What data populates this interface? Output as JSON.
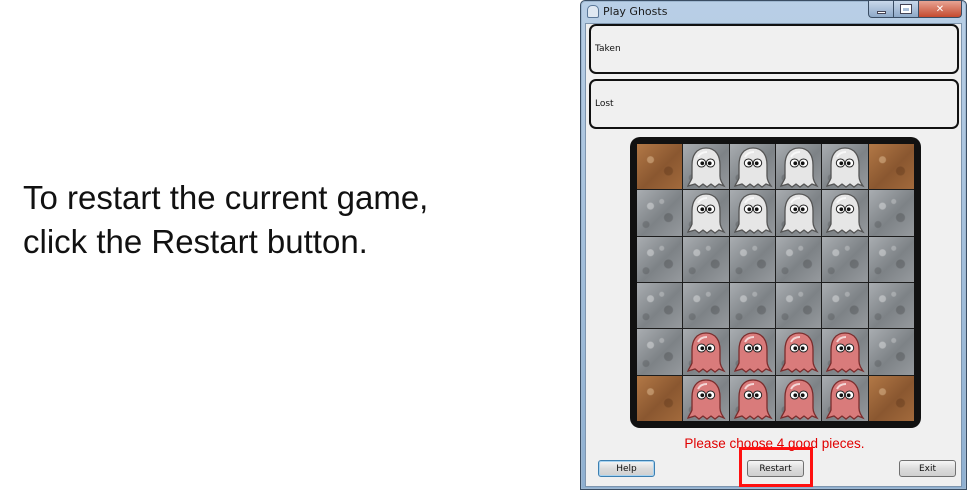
{
  "instruction": {
    "line1": "To restart the current game,",
    "line2_prefix": "click the ",
    "line2_bold": "Restart",
    "line2_suffix": " button."
  },
  "window": {
    "title": "Play Ghosts",
    "taken_label": "Taken",
    "lost_label": "Lost",
    "status_message": "Please choose 4 good pieces.",
    "buttons": {
      "help": "Help",
      "restart": "Restart",
      "exit": "Exit"
    }
  },
  "board": {
    "rows": 6,
    "cols": 6,
    "corner_cells": [
      [
        0,
        0
      ],
      [
        0,
        5
      ],
      [
        5,
        0
      ],
      [
        5,
        5
      ]
    ],
    "pieces": [
      [
        "",
        "white",
        "white",
        "white",
        "white",
        ""
      ],
      [
        "",
        "white",
        "white",
        "white",
        "white",
        ""
      ],
      [
        "",
        "",
        "",
        "",
        "",
        ""
      ],
      [
        "",
        "",
        "",
        "",
        "",
        ""
      ],
      [
        "",
        "red",
        "red",
        "red",
        "red",
        ""
      ],
      [
        "",
        "red",
        "red",
        "red",
        "red",
        ""
      ]
    ]
  },
  "colors": {
    "status_text": "#e00000",
    "highlight": "#ff1010",
    "ghost_white": "#e6e6e6",
    "ghost_red": "#d97b7b"
  },
  "icons": {
    "ghost": "ghost-icon",
    "app": "app-icon",
    "minimize": "minimize-icon",
    "maximize": "maximize-icon",
    "close": "close-icon"
  }
}
